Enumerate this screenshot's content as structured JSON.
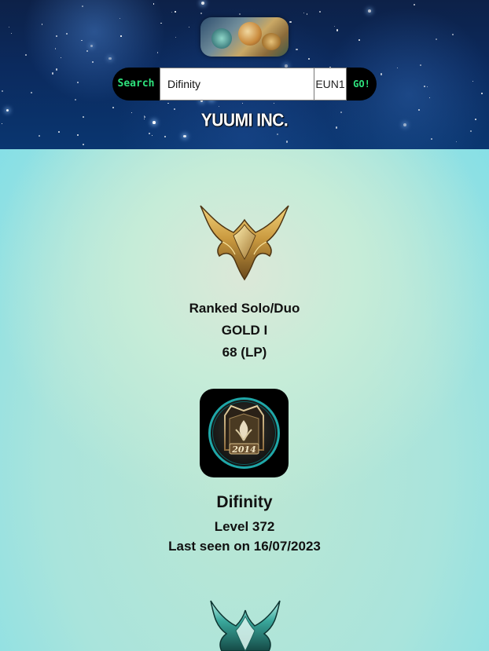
{
  "header": {
    "logo_name": "yuumi-splash-logo",
    "search_label": "Search",
    "search_value": "Difinity",
    "region": "EUN1",
    "go_label": "GO!",
    "brand": "YUUMI INC."
  },
  "ranked": {
    "queue": "Ranked Solo/Duo",
    "tier": "GOLD I",
    "lp": "68 (LP)",
    "emblem_icon": "gold-rank-emblem-icon"
  },
  "profile": {
    "icon": "profile-icon-2014",
    "icon_year": "2014",
    "name": "Difinity",
    "level": "Level 372",
    "last_seen": "Last seen on 16/07/2023"
  },
  "colors": {
    "header_bg": "#0b2a5e",
    "accent_green": "#2ee37d",
    "main_bg": "#a9e4dc",
    "gold": "#c9a04a",
    "teal_emblem": "#2f8f86"
  }
}
